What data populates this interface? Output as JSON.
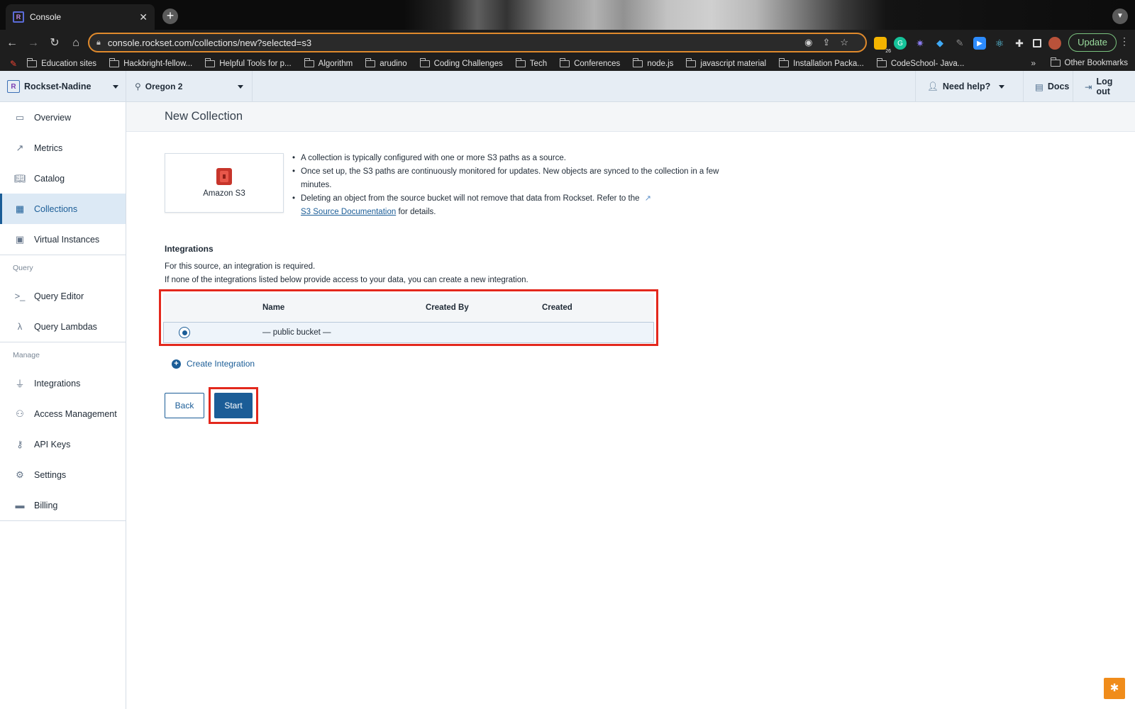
{
  "browser": {
    "tab_title": "Console",
    "url": "console.rockset.com/collections/new?selected=s3",
    "update_label": "Update",
    "ext_badge": "26",
    "bookmarks": [
      "Education sites",
      "Hackbright-fellow...",
      "Helpful Tools for p...",
      "Algorithm",
      "arudino",
      "Coding Challenges",
      "Tech",
      "Conferences",
      "node.js",
      "javascript material",
      "Installation Packa...",
      "CodeSchool- Java..."
    ],
    "bookmarks_more": "»",
    "other_bookmarks": "Other Bookmarks"
  },
  "header": {
    "org_name": "Rockset-Nadine",
    "region": "Oregon 2",
    "help_label": "Need help?",
    "docs_label": "Docs",
    "logout_label": "Log out"
  },
  "sidebar": {
    "items_top": [
      {
        "label": "Overview",
        "icon": "monitor-icon"
      },
      {
        "label": "Metrics",
        "icon": "chart-icon"
      },
      {
        "label": "Catalog",
        "icon": "book-icon"
      },
      {
        "label": "Collections",
        "icon": "table-icon"
      },
      {
        "label": "Virtual Instances",
        "icon": "chip-icon"
      }
    ],
    "query_section": "Query",
    "items_query": [
      {
        "label": "Query Editor",
        "icon": "terminal-icon"
      },
      {
        "label": "Query Lambdas",
        "icon": "lambda-icon"
      }
    ],
    "manage_section": "Manage",
    "items_manage": [
      {
        "label": "Integrations",
        "icon": "plug-icon"
      },
      {
        "label": "Access Management",
        "icon": "user-gear-icon"
      },
      {
        "label": "API Keys",
        "icon": "key-icon"
      },
      {
        "label": "Settings",
        "icon": "gear-icon"
      },
      {
        "label": "Billing",
        "icon": "credit-card-icon"
      }
    ],
    "active": "Collections"
  },
  "page": {
    "title": "New Collection",
    "source_name": "Amazon S3",
    "bullets": {
      "b1": "A collection is typically configured with one or more S3 paths as a source.",
      "b2": "Once set up, the S3 paths are continuously monitored for updates. New objects are synced to the collection in a few minutes.",
      "b3_pre": "Deleting an object from the source bucket will not remove that data from Rockset. Refer to the",
      "b3_link": "S3 Source Documentation",
      "b3_post": "for details."
    },
    "integrations": {
      "heading": "Integrations",
      "line1": "For this source, an integration is required.",
      "line2": "If none of the integrations listed below provide access to your data, you can create a new integration.",
      "columns": [
        "Name",
        "Created By",
        "Created"
      ],
      "rows": [
        {
          "name": "— public bucket —",
          "created_by": "",
          "created": "",
          "selected": true
        }
      ]
    },
    "create_integration_label": "Create Integration",
    "back_label": "Back",
    "start_label": "Start"
  },
  "colors": {
    "accent": "#1b5d97",
    "highlight": "#e3281d",
    "header_bg": "#e6edf4"
  }
}
